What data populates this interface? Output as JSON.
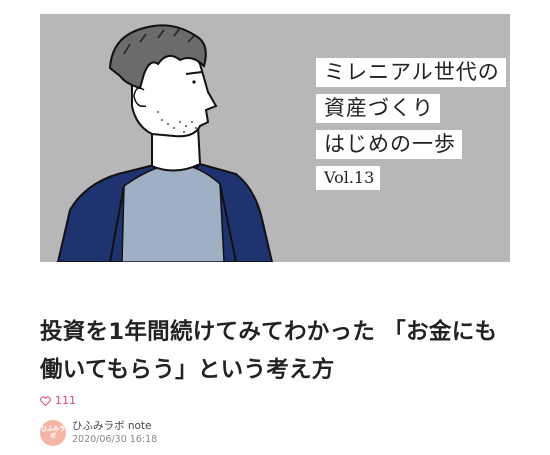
{
  "hero": {
    "title_lines": [
      "ミレニアル世代の",
      "資産づくり",
      "はじめの一歩"
    ],
    "volume": "Vol.13"
  },
  "article": {
    "title": "投資を1年間続けてみてわかった 「お金にも働いてもらう」という考え方",
    "likes": "111"
  },
  "author": {
    "avatar_text": "ひふみラボ",
    "name": "ひふみラボ note",
    "date": "2020/06/30 16:18"
  },
  "colors": {
    "hero_background": "#b7b7ba",
    "like_color": "#d74a68",
    "jacket": "#1f3370",
    "shirt": "#9fb0c4"
  },
  "icons": {
    "like": "heart-icon"
  }
}
